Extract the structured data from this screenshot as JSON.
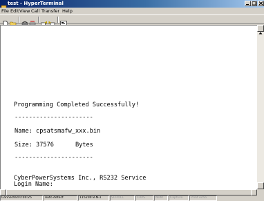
{
  "window": {
    "title": "test - HyperTerminal"
  },
  "menu": [
    "File",
    "Edit",
    "View",
    "Call",
    "Transfer",
    "Help"
  ],
  "toolbar": {
    "buttons": [
      "new-document-icon",
      "open-folder-icon",
      "phone-call-icon",
      "disconnect-icon",
      "send-icon",
      "receive-icon",
      "properties-icon"
    ]
  },
  "terminal": {
    "lines": [
      "Programming Completed Successfully!",
      "----------------------",
      "Name: cpsatsmafw_xxx.bin",
      "Size: 37576      Bytes",
      "----------------------",
      "CyberPowerSystems Inc., RS232 Service",
      "Login Name:"
    ]
  },
  "status": {
    "connected": "Connected 0:00:25",
    "detect": "Auto detect",
    "baud": "115200 8-N-1",
    "scroll": "SCROLL",
    "caps": "CAPS",
    "num": "NUM",
    "capture": "Capture",
    "print_echo": "Print echo"
  }
}
